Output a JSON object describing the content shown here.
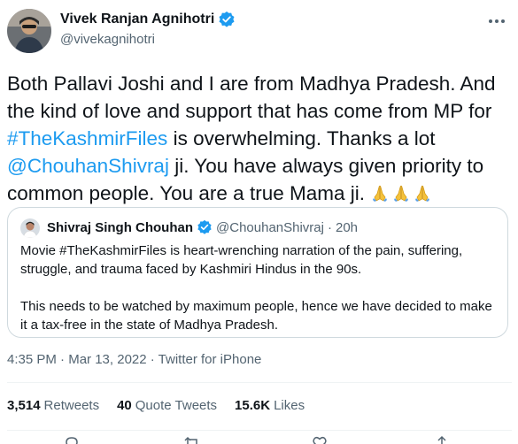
{
  "author": {
    "display_name": "Vivek Ranjan Agnihotri",
    "handle": "@vivekagnihotri",
    "verified": true
  },
  "tweet": {
    "segments": [
      {
        "text": "Both Pallavi Joshi and I are from Madhya Pradesh. And the kind of love and support that has come from MP for ",
        "link": false
      },
      {
        "text": "#TheKashmirFiles",
        "link": true
      },
      {
        "text": " is overwhelming. Thanks a lot ",
        "link": false
      },
      {
        "text": "@ChouhanShivraj",
        "link": true
      },
      {
        "text": " ji. You have always given priority to common people. You are a true Mama ji. ",
        "link": false
      }
    ],
    "emoji": "folded-hands-emoji"
  },
  "quoted": {
    "display_name": "Shivraj Singh Chouhan",
    "handle": "@ChouhanShivraj",
    "separator": "·",
    "time": "20h",
    "paragraph1": "Movie #TheKashmirFiles is heart-wrenching narration of the pain, suffering, struggle, and trauma faced by Kashmiri Hindus in the 90s.",
    "paragraph2": "This needs to be watched by maximum people, hence we have decided to make it a tax-free in the state of Madhya Pradesh."
  },
  "meta": {
    "time": "4:35 PM",
    "date": "Mar 13, 2022",
    "source": "Twitter for iPhone"
  },
  "stats": {
    "retweets_count": "3,514",
    "retweets_label": "Retweets",
    "quotes_count": "40",
    "quotes_label": "Quote Tweets",
    "likes_count": "15.6K",
    "likes_label": "Likes"
  },
  "colors": {
    "link": "#1d9bf0",
    "text": "#0f1419",
    "secondary": "#536471",
    "border": "#cfd9de",
    "verified": "#1d9bf0"
  },
  "icons": [
    "verified-badge-icon",
    "more-options-icon",
    "reply-icon",
    "retweet-icon",
    "like-icon",
    "share-icon"
  ]
}
